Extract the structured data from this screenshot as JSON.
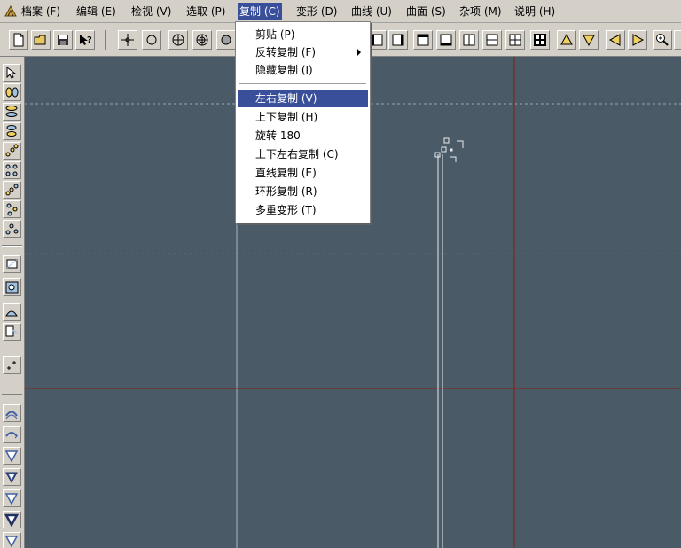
{
  "menubar": {
    "items": [
      {
        "label": "档案 (F)"
      },
      {
        "label": "编辑 (E)"
      },
      {
        "label": "检视 (V)"
      },
      {
        "label": "选取 (P)"
      },
      {
        "label": "复制 (C)"
      },
      {
        "label": "变形 (D)"
      },
      {
        "label": "曲线 (U)"
      },
      {
        "label": "曲面 (S)"
      },
      {
        "label": "杂项 (M)"
      },
      {
        "label": "说明 (H)"
      }
    ]
  },
  "copy_menu": {
    "items": [
      {
        "label": "剪贴 (P)"
      },
      {
        "label": "反转复制 (F)"
      },
      {
        "label": "隐藏复制 (I)"
      },
      {
        "label": "左右复制 (V)"
      },
      {
        "label": "上下复制 (H)"
      },
      {
        "label": "旋转 180"
      },
      {
        "label": "上下左右复制 (C)"
      },
      {
        "label": "直线复制 (E)"
      },
      {
        "label": "环形复制 (R)"
      },
      {
        "label": "多重变形 (T)"
      }
    ]
  },
  "colors": {
    "viewport_bg": "#4a5a66",
    "axis_red": "#7a2a22",
    "menu_highlight": "#3a4f9a"
  }
}
